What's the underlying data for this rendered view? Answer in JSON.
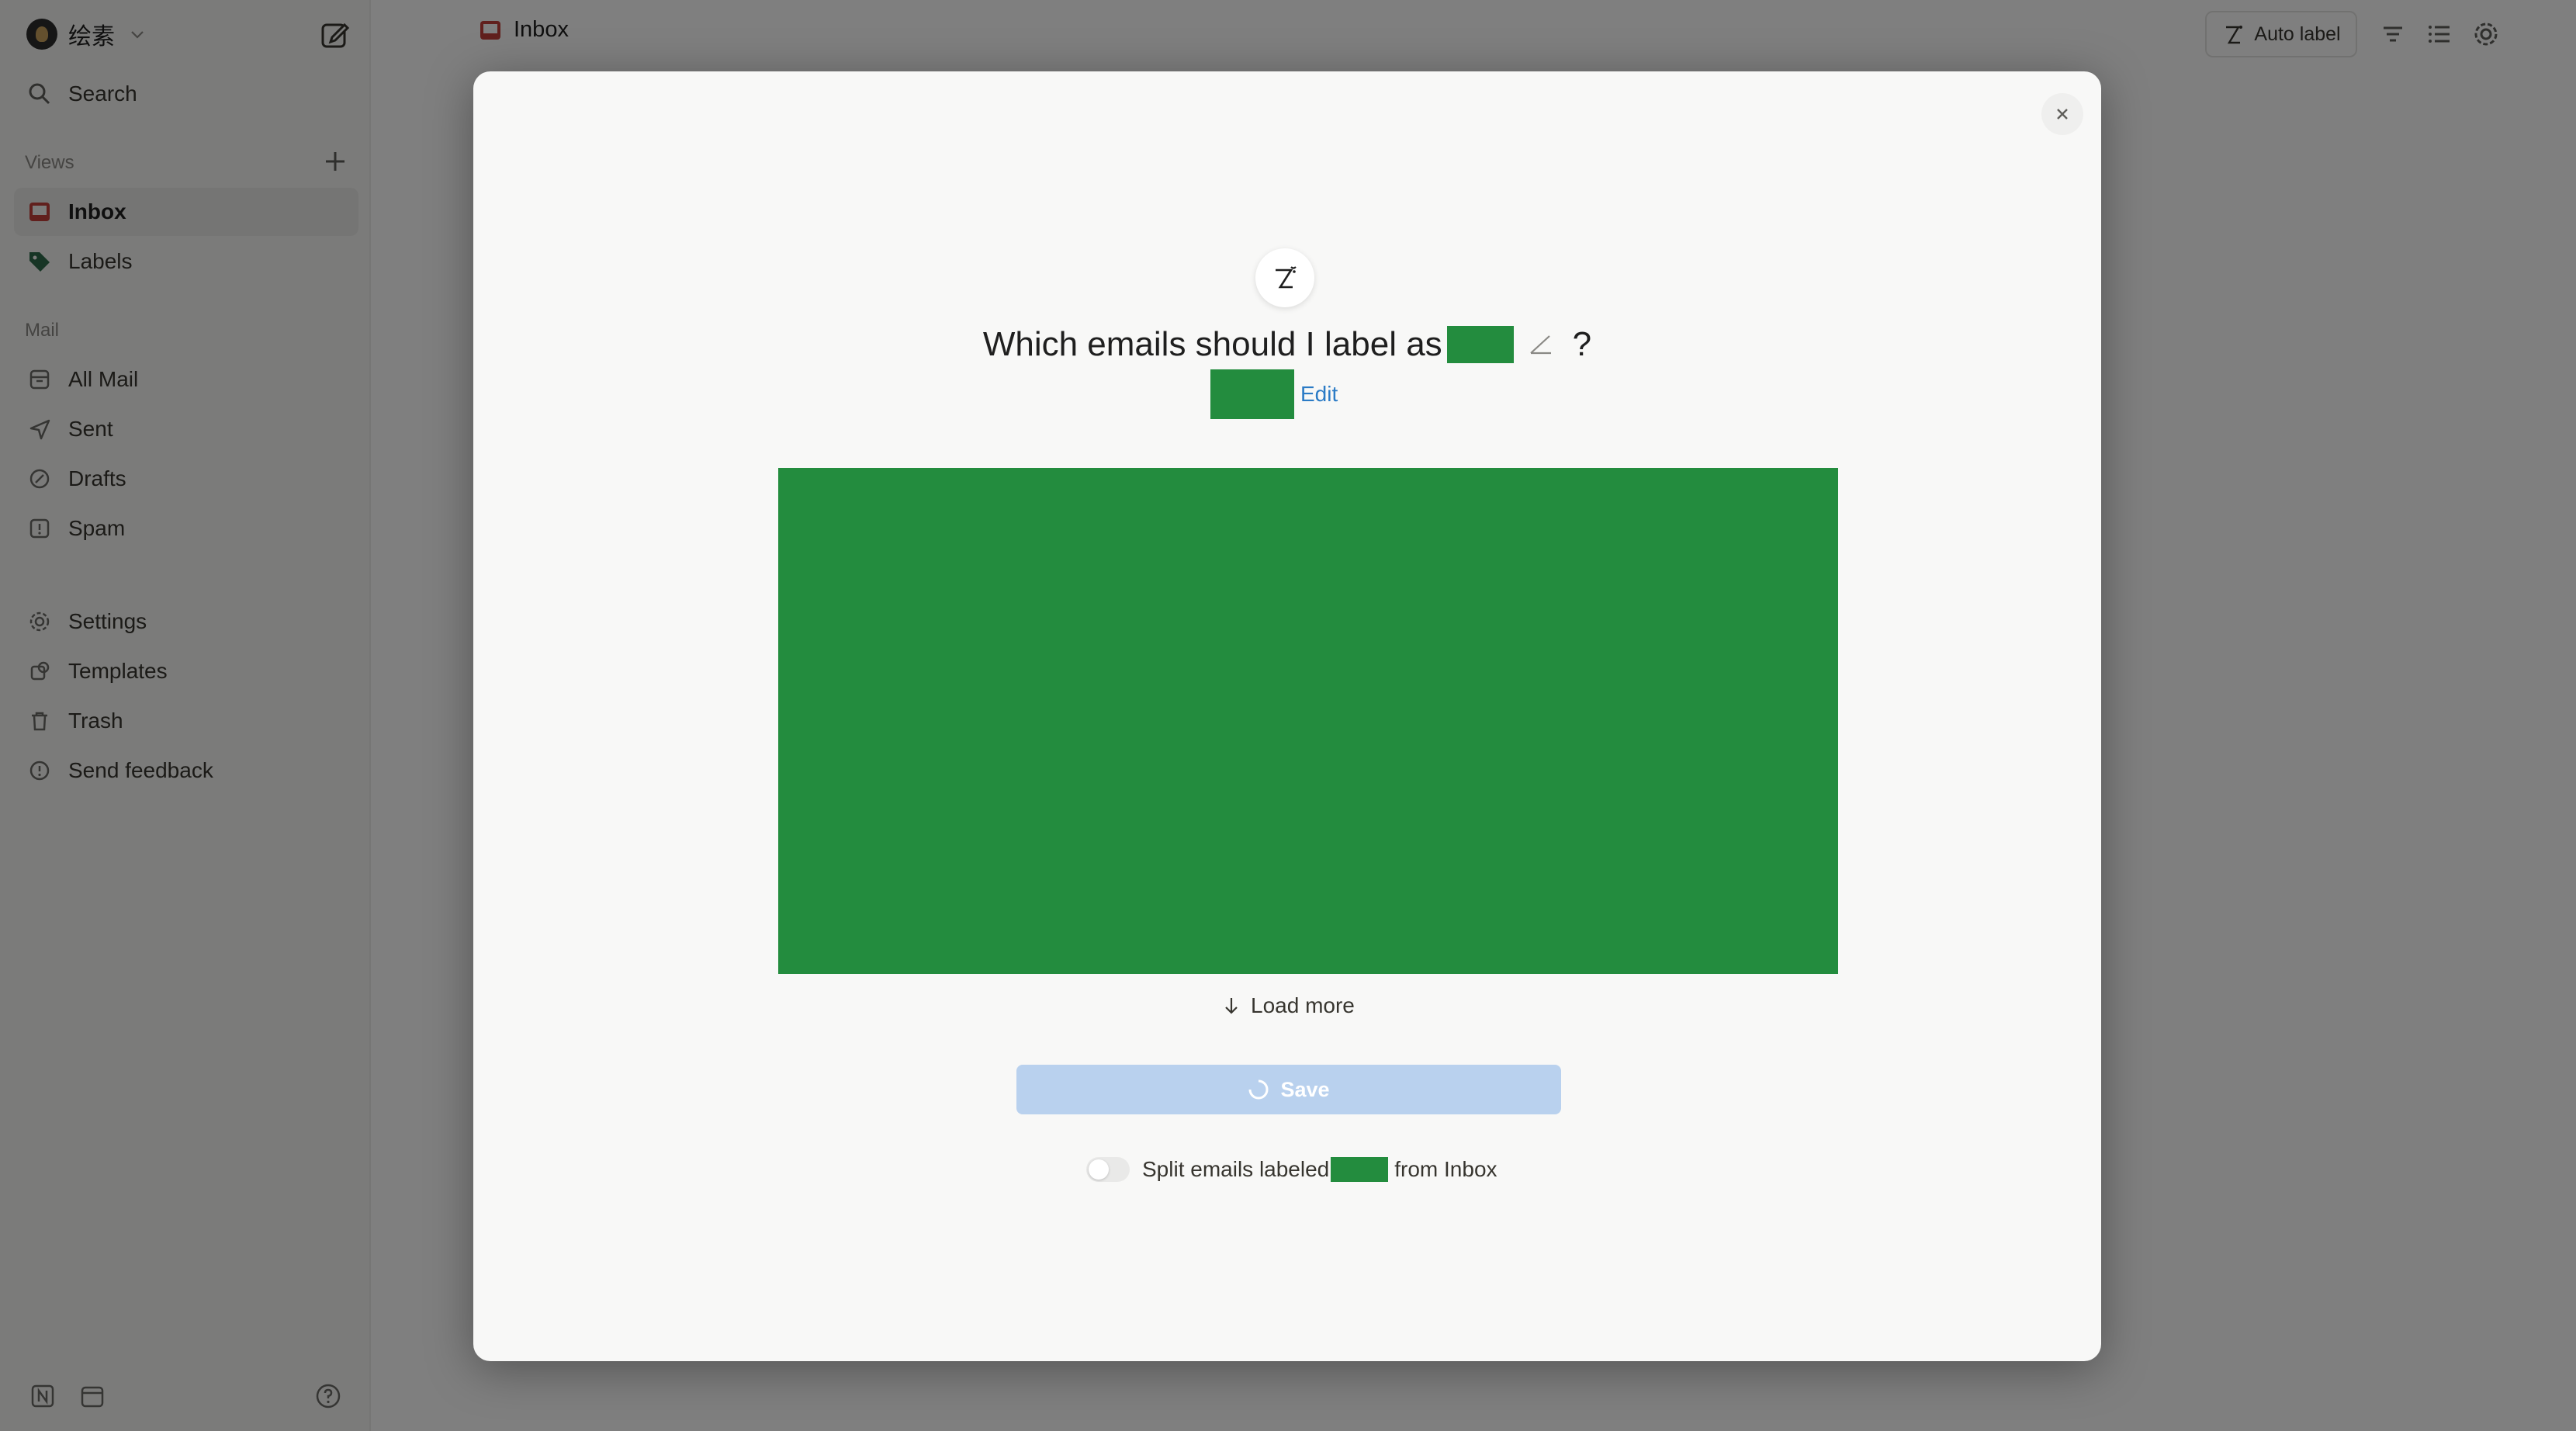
{
  "workspace": {
    "name": "绘素"
  },
  "sidebar": {
    "search_label": "Search",
    "views_section": "Views",
    "views": [
      {
        "label": "Inbox",
        "icon": "inbox-icon",
        "active": true
      },
      {
        "label": "Labels",
        "icon": "tag-icon"
      }
    ],
    "mail_section": "Mail",
    "mail": [
      {
        "label": "All Mail",
        "icon": "archive-icon"
      },
      {
        "label": "Sent",
        "icon": "send-icon"
      },
      {
        "label": "Drafts",
        "icon": "drafts-icon"
      },
      {
        "label": "Spam",
        "icon": "spam-icon"
      }
    ],
    "other": [
      {
        "label": "Settings",
        "icon": "gear-icon"
      },
      {
        "label": "Templates",
        "icon": "templates-icon"
      },
      {
        "label": "Trash",
        "icon": "trash-icon"
      },
      {
        "label": "Send feedback",
        "icon": "feedback-icon"
      }
    ]
  },
  "header": {
    "title": "Inbox",
    "auto_label": "Auto label"
  },
  "modal": {
    "title": "Which emails should I label as",
    "question_mark": "?",
    "edit_label": "Edit",
    "load_more_label": "Load more",
    "save_label": "Save",
    "split_prefix": "Split emails labeled",
    "split_suffix": "from Inbox",
    "split_enabled": false
  },
  "colors": {
    "accent": "#2b7bc6",
    "label_redaction": "#238c3e",
    "inbox_icon": "#c2403a",
    "tag_icon": "#2e6b4a",
    "save_disabled": "#b9d1ee"
  }
}
